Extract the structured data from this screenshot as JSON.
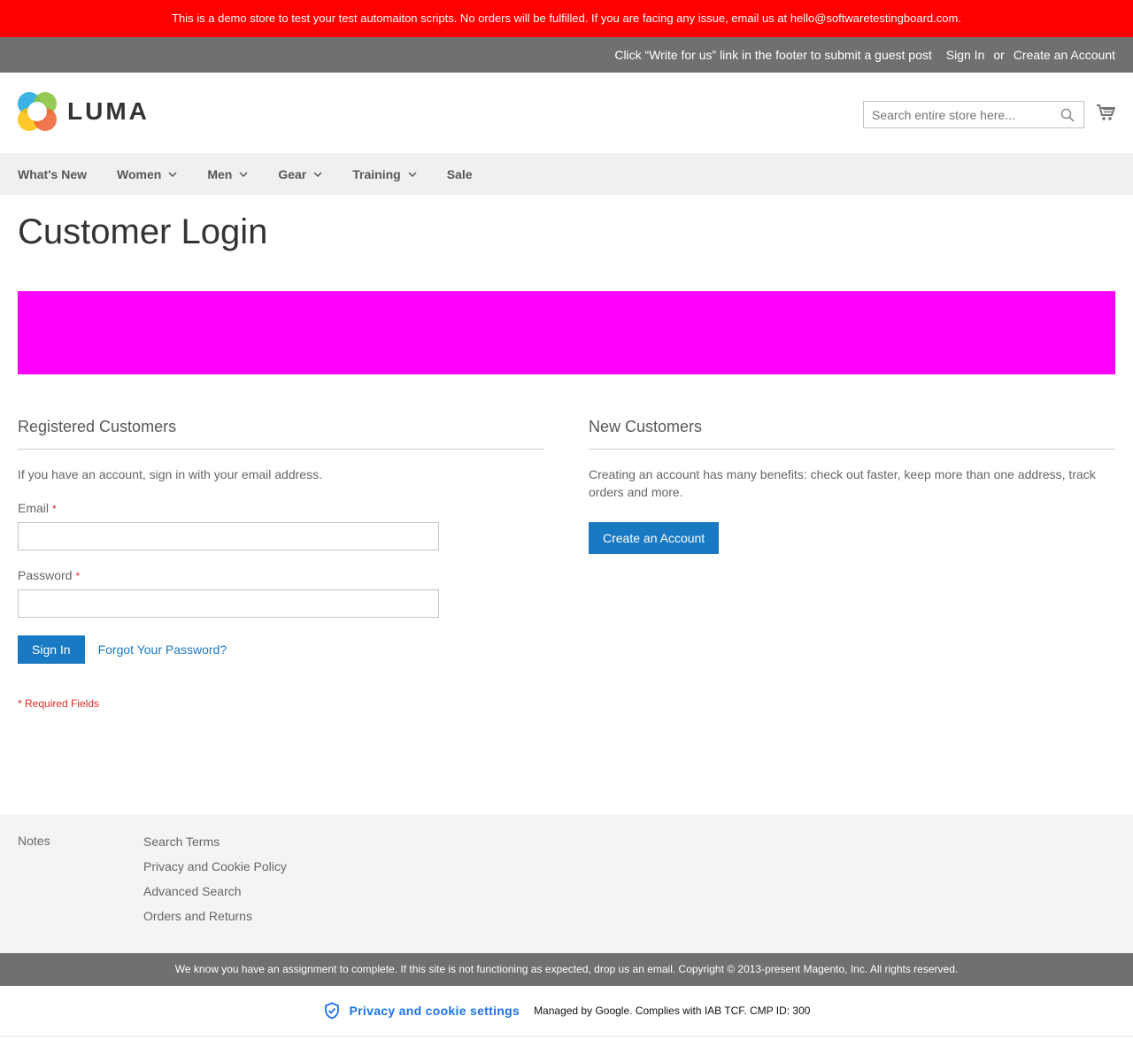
{
  "banner": {
    "text": "This is a demo store to test your test automaiton scripts. No orders will be fulfilled. If you are facing any issue, email us at hello@softwaretestingboard.com."
  },
  "panel_header": {
    "guest_post": "Click “Write for us” link in the footer to submit a guest post",
    "sign_in": "Sign In",
    "or": "or",
    "create_account": "Create an Account"
  },
  "header": {
    "logo_text": "LUMA",
    "search_placeholder": "Search entire store here...",
    "search_value": ""
  },
  "nav": {
    "items": [
      {
        "label": "What's New",
        "has_dropdown": false
      },
      {
        "label": "Women",
        "has_dropdown": true
      },
      {
        "label": "Men",
        "has_dropdown": true
      },
      {
        "label": "Gear",
        "has_dropdown": true
      },
      {
        "label": "Training",
        "has_dropdown": true
      },
      {
        "label": "Sale",
        "has_dropdown": false
      }
    ]
  },
  "page": {
    "title": "Customer Login",
    "promo_color": "#ff00ff"
  },
  "registered": {
    "title": "Registered Customers",
    "intro": "If you have an account, sign in with your email address.",
    "email_label": "Email",
    "email_value": "",
    "password_label": "Password",
    "password_value": "",
    "required_mark": "*",
    "sign_in_button": "Sign In",
    "forgot_link": "Forgot Your Password?",
    "required_note": "* Required Fields"
  },
  "new_customers": {
    "title": "New Customers",
    "text": "Creating an account has many benefits: check out faster, keep more than one address, track orders and more.",
    "create_button": "Create an Account"
  },
  "footer": {
    "notes": "Notes",
    "links": [
      "Search Terms",
      "Privacy and Cookie Policy",
      "Advanced Search",
      "Orders and Returns"
    ],
    "copyright": "We know you have an assignment to complete. If this site is not functioning as expected, drop us an email. Copyright © 2013-present Magento, Inc. All rights reserved."
  },
  "consent": {
    "link": "Privacy and cookie settings",
    "managed": "Managed by Google. Complies with IAB TCF. CMP ID: 300"
  },
  "colors": {
    "banner_red": "#ff0000",
    "header_gray": "#6e716e",
    "primary_blue": "#1979c3",
    "required_red": "#e02b27",
    "nav_bg": "#f0f0f0"
  }
}
